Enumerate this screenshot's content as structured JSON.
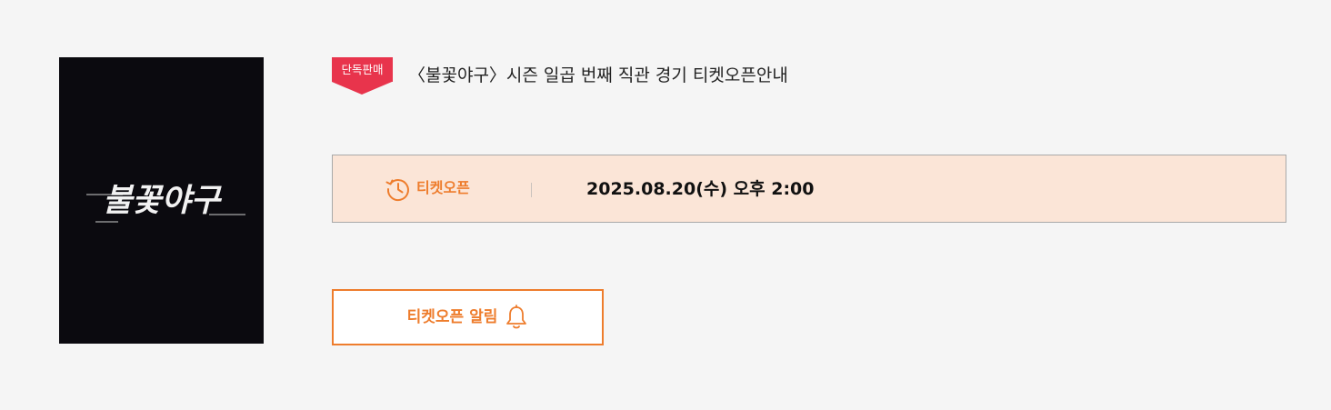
{
  "poster": {
    "logo_text": "불꽃야구"
  },
  "badge": {
    "label": "단독판매"
  },
  "event": {
    "title": "〈불꽃야구〉시즌 일곱 번째 직관 경기 티켓오픈안내"
  },
  "ticket_open": {
    "icon": "history-clock-icon",
    "label": "티켓오픈",
    "date": "2025.08.20(수) 오후 2:00"
  },
  "alert_button": {
    "label": "티켓오픈 알림",
    "icon": "bell-icon"
  },
  "colors": {
    "accent": "#ee7d2d",
    "badge": "#e8344c",
    "open_box_bg": "#fbe5d7",
    "poster_bg": "#0b0a0f",
    "page_bg": "#f5f5f5"
  }
}
